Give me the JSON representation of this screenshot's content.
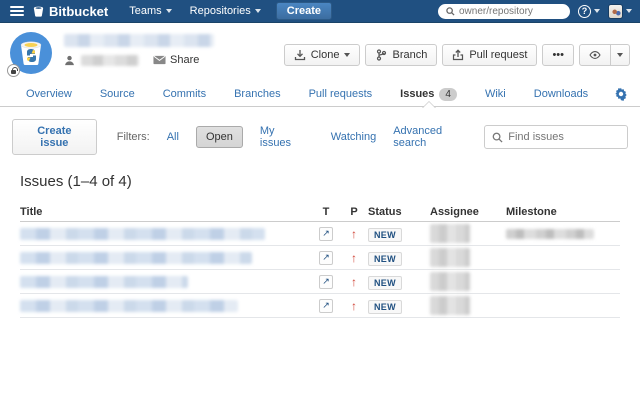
{
  "colors": {
    "navbar": "#205081",
    "link": "#3572b0",
    "priority_major": "#d04437",
    "status_text": "#205081"
  },
  "topnav": {
    "brand": "Bitbucket",
    "menus": [
      {
        "label": "Teams"
      },
      {
        "label": "Repositories"
      }
    ],
    "create_label": "Create",
    "search_placeholder": "owner/repository",
    "help_glyph": "?"
  },
  "repo_header": {
    "share_label": "Share",
    "actions": {
      "clone": "Clone",
      "branch": "Branch",
      "pull_request": "Pull request",
      "more": "•••"
    }
  },
  "tabs": {
    "items": [
      {
        "label": "Overview"
      },
      {
        "label": "Source"
      },
      {
        "label": "Commits"
      },
      {
        "label": "Branches"
      },
      {
        "label": "Pull requests"
      },
      {
        "label": "Issues",
        "active": true,
        "count": "4"
      },
      {
        "label": "Wiki"
      },
      {
        "label": "Downloads"
      }
    ]
  },
  "filters": {
    "create_issue_label": "Create issue",
    "filters_label": "Filters:",
    "options": [
      {
        "label": "All"
      },
      {
        "label": "Open",
        "selected": true
      },
      {
        "label": "My issues"
      },
      {
        "label": "Watching"
      }
    ],
    "advanced_search_label": "Advanced search",
    "find_placeholder": "Find issues"
  },
  "issues": {
    "heading": "Issues (1–4 of 4)",
    "columns": {
      "title": "Title",
      "type": "T",
      "priority": "P",
      "status": "Status",
      "assignee": "Assignee",
      "milestone": "Milestone"
    },
    "type_glyph": "↗",
    "priority_glyph": "↑",
    "rows": [
      {
        "status": "NEW",
        "title_redacted": true,
        "assignee_redacted": true,
        "milestone_redacted": true
      },
      {
        "status": "NEW",
        "title_redacted": true,
        "assignee_redacted": true
      },
      {
        "status": "NEW",
        "title_redacted": true,
        "assignee_redacted": true
      },
      {
        "status": "NEW",
        "title_redacted": true,
        "assignee_redacted": true
      }
    ]
  }
}
